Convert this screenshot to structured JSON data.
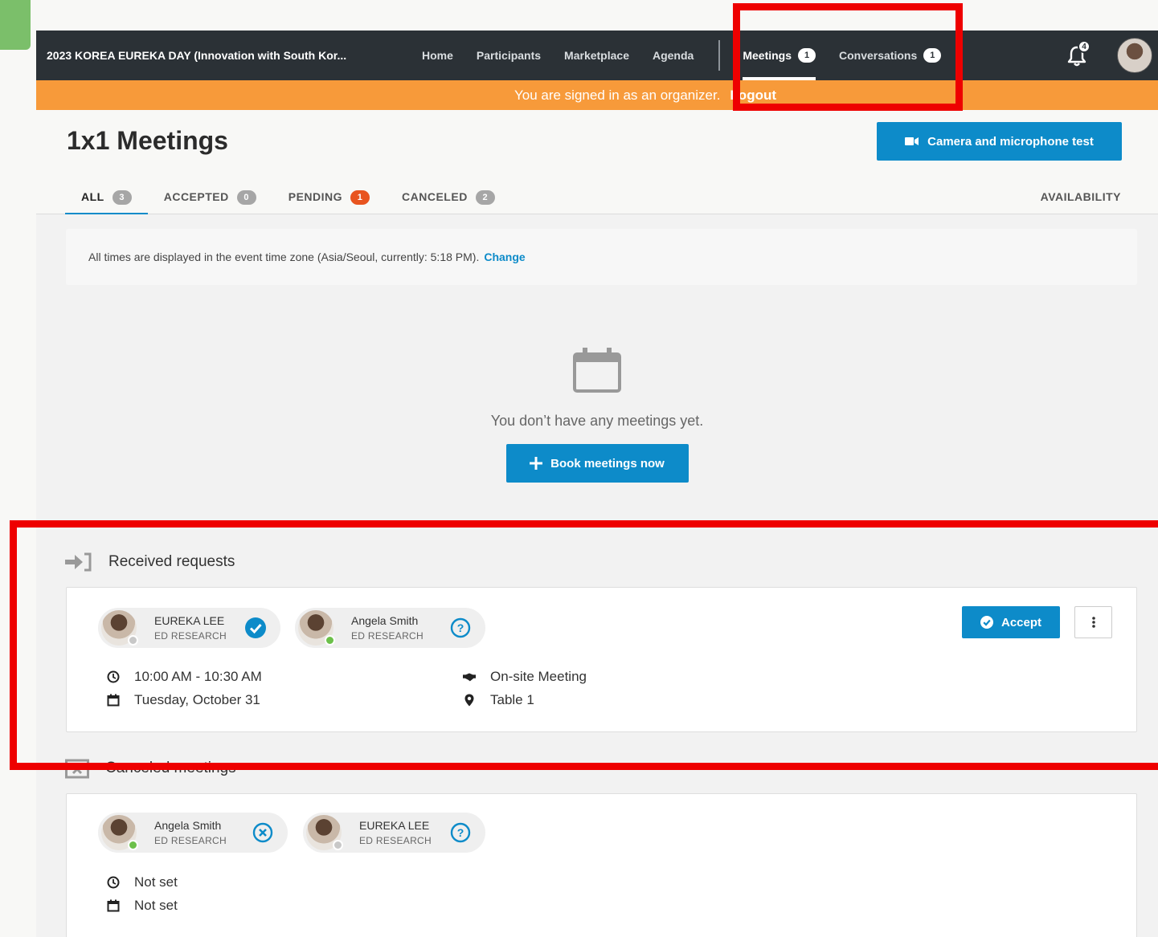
{
  "nav": {
    "event_title": "2023 KOREA EUREKA DAY (Innovation with South Kor...",
    "items": [
      {
        "label": "Home"
      },
      {
        "label": "Participants"
      },
      {
        "label": "Marketplace"
      },
      {
        "label": "Agenda"
      }
    ],
    "meetings": {
      "label": "Meetings",
      "badge": "1"
    },
    "conversations": {
      "label": "Conversations",
      "badge": "1"
    },
    "notifications_badge": "4"
  },
  "organizer_bar": {
    "text": "You are signed in as an organizer.",
    "logout": "Logout"
  },
  "page": {
    "title": "1x1 Meetings",
    "camera_button": "Camera and microphone test",
    "tabs": [
      {
        "label": "ALL",
        "count": "3"
      },
      {
        "label": "ACCEPTED",
        "count": "0"
      },
      {
        "label": "PENDING",
        "count": "1"
      },
      {
        "label": "CANCELED",
        "count": "2"
      }
    ],
    "availability": "AVAILABILITY"
  },
  "timezone": {
    "text": "All times are displayed in the event time zone (Asia/Seoul, currently: 5:18 PM).",
    "change": "Change"
  },
  "empty_state": {
    "text": "You don’t have any meetings yet.",
    "button": "Book meetings now"
  },
  "received": {
    "heading": "Received requests",
    "participants": [
      {
        "name": "EUREKA LEE",
        "role": "ED RESEARCH",
        "status_color": "#c8c8c8",
        "state": "accepted"
      },
      {
        "name": "Angela Smith",
        "role": "ED RESEARCH",
        "status_color": "#6cc04a",
        "state": "pending"
      }
    ],
    "time": "10:00 AM - 10:30 AM",
    "date": "Tuesday, October 31",
    "type": "On-site Meeting",
    "location": "Table 1",
    "accept_button": "Accept"
  },
  "canceled": {
    "heading": "Canceled meetings",
    "participants": [
      {
        "name": "Angela Smith",
        "role": "ED RESEARCH",
        "status_color": "#6cc04a",
        "state": "declined"
      },
      {
        "name": "EUREKA LEE",
        "role": "ED RESEARCH",
        "status_color": "#c8c8c8",
        "state": "pending"
      }
    ],
    "time": "Not set",
    "date": "Not set"
  },
  "colors": {
    "primary": "#0d8bc9",
    "nav_bg": "#2b3136",
    "organizer_bar": "#f79a3a",
    "pending_badge": "#e8541f",
    "annotation": "#ee0000"
  }
}
